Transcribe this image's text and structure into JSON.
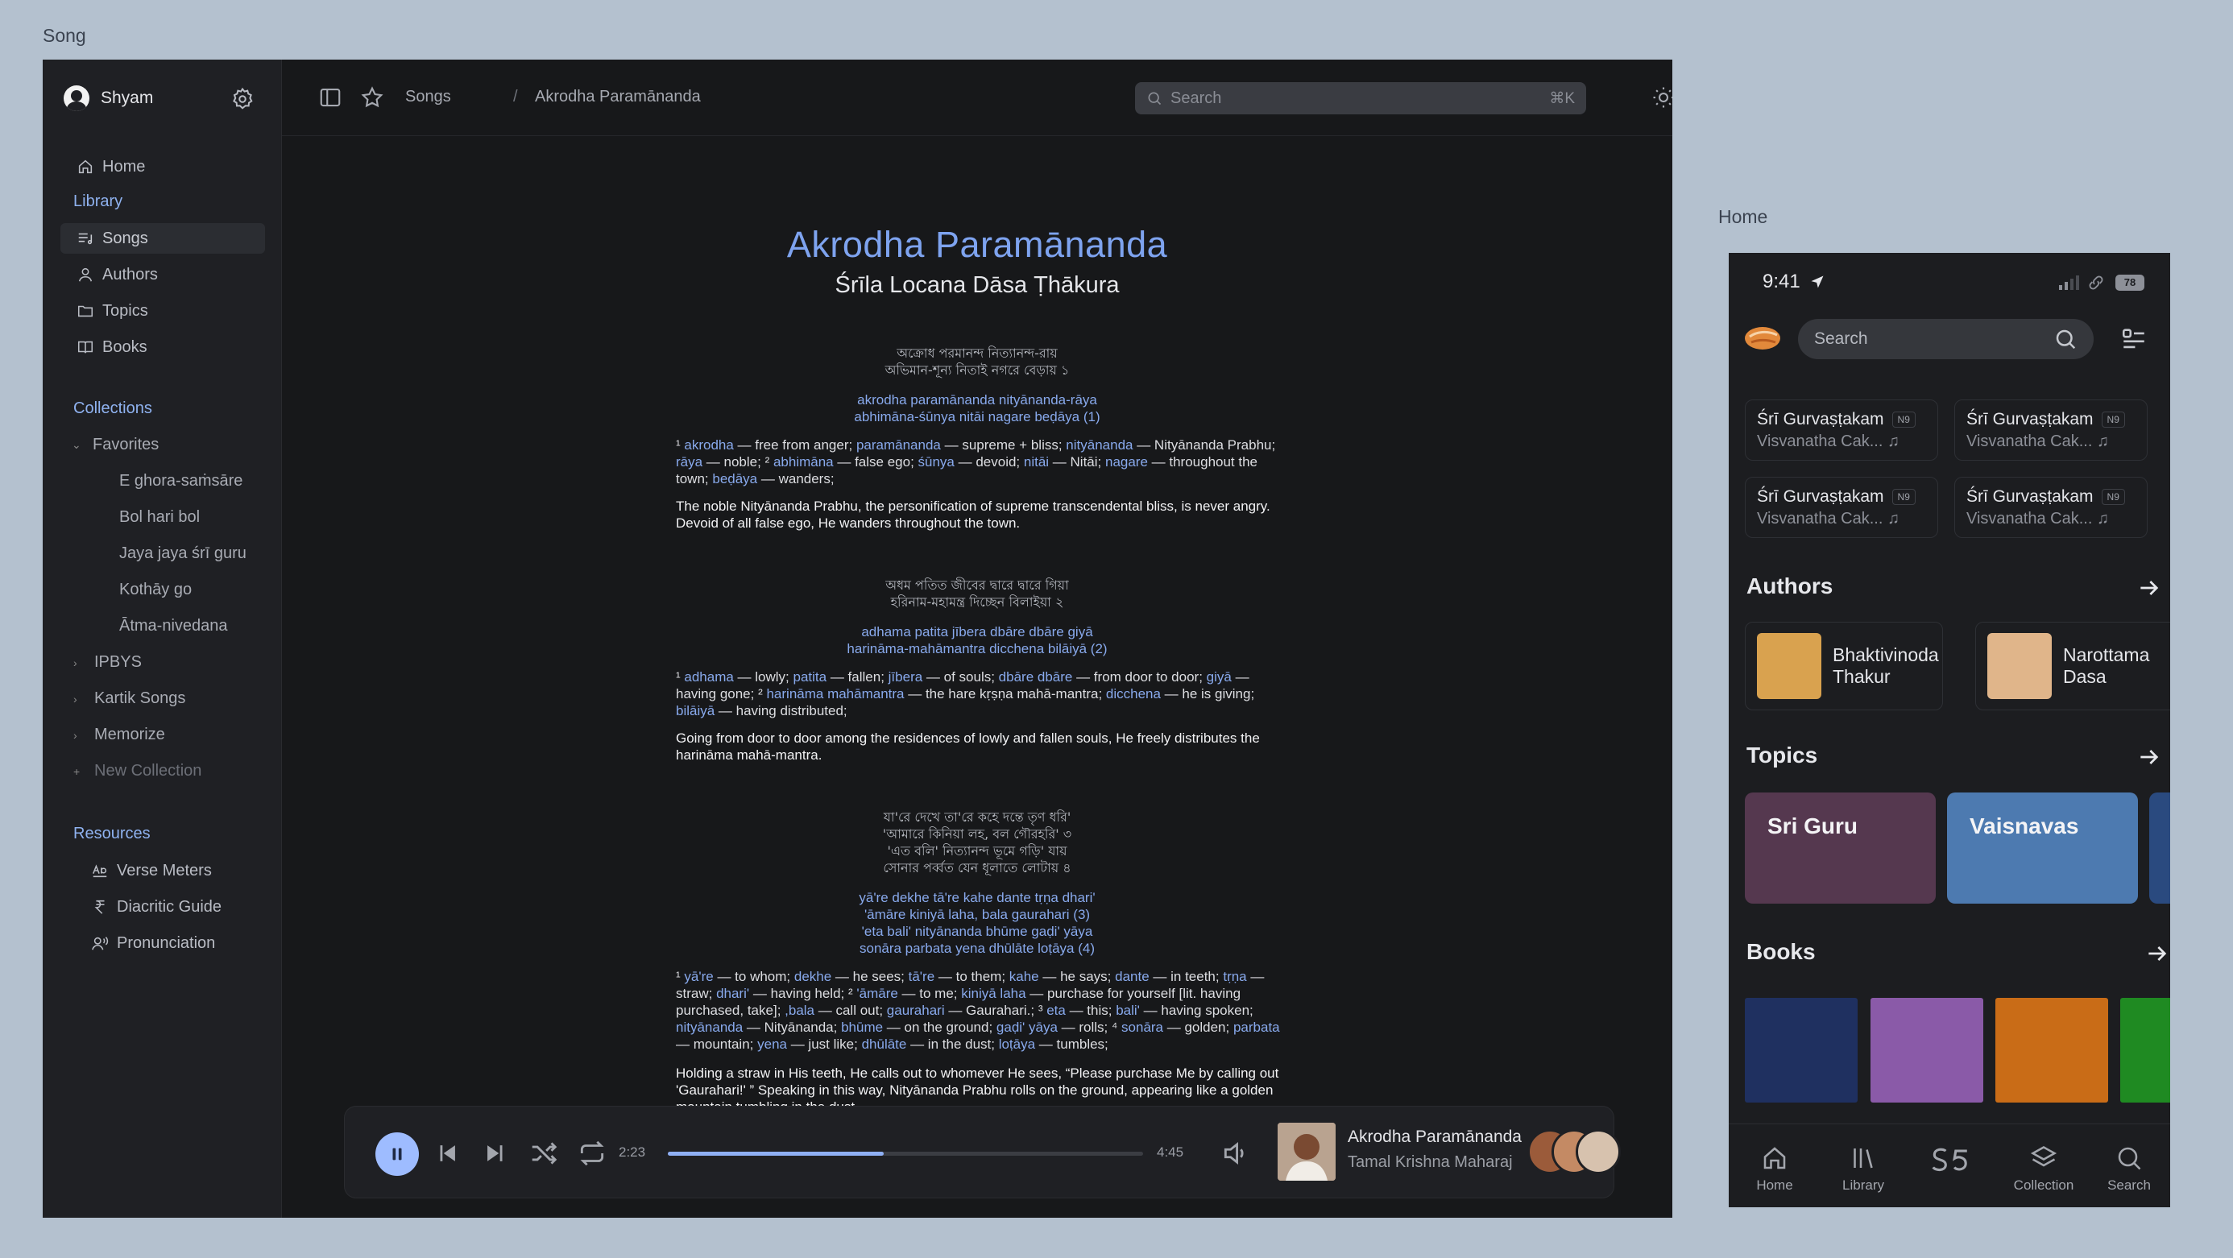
{
  "frames": {
    "song_label": "Song",
    "home_label": "Home"
  },
  "sidebar": {
    "user": "Shyam",
    "nav": [
      {
        "label": "Home"
      }
    ],
    "library_heading": "Library",
    "library": [
      {
        "label": "Songs"
      },
      {
        "label": "Authors"
      },
      {
        "label": "Topics"
      },
      {
        "label": "Books"
      }
    ],
    "collections_heading": "Collections",
    "favorites_label": "Favorites",
    "favorites": [
      "E ghora-saṁsāre",
      "Bol hari bol",
      "Jaya jaya śrī guru",
      "Kothāy go",
      "Ātma-nivedana"
    ],
    "folders": [
      "IPBYS",
      "Kartik Songs",
      "Memorize"
    ],
    "new_collection": "New Collection",
    "resources_heading": "Resources",
    "resources": [
      {
        "label": "Verse Meters"
      },
      {
        "label": "Diacritic Guide"
      },
      {
        "label": "Pronunciation"
      }
    ]
  },
  "topbar": {
    "crumb_root": "Songs",
    "crumb_sep": "/",
    "crumb_current": "Akrodha Paramānanda",
    "search_placeholder": "Search",
    "search_shortcut": "⌘K"
  },
  "song": {
    "title": "Akrodha Paramānanda",
    "author": "Śrīla Locana Dāsa Ṭhākura",
    "verses": [
      {
        "bengali": [
          "অক্রোধ পরমানন্দ নিত্যানন্দ-রায়",
          "অভিমান-শূন্য নিতাই নগরে বেড়ায়    ১"
        ],
        "translit": [
          "akrodha paramānanda nityānanda-rāya",
          "abhimāna-śūnya nitāi nagare beḍāya (1)"
        ],
        "synonyms": [
          [
            [
              "¹ ",
              ""
            ],
            [
              "akrodha",
              "w"
            ],
            [
              " — free from anger;  ",
              ""
            ],
            [
              "paramānanda",
              "w"
            ],
            [
              " — supreme + bliss;  ",
              ""
            ],
            [
              "nityānanda",
              "w"
            ],
            [
              " — Nityānanda Prabhu;",
              ""
            ]
          ],
          [
            [
              "rāya",
              "w"
            ],
            [
              " — noble;  ² ",
              ""
            ],
            [
              "abhimāna",
              "w"
            ],
            [
              " — false ego;  ",
              ""
            ],
            [
              "śūnya",
              "w"
            ],
            [
              " — devoid;  ",
              ""
            ],
            [
              "nitāi",
              "w"
            ],
            [
              " — Nitāi;  ",
              ""
            ],
            [
              "nagare",
              "w"
            ],
            [
              " — throughout the",
              ""
            ]
          ],
          [
            [
              "town;  ",
              ""
            ],
            [
              "beḍāya",
              "w"
            ],
            [
              " — wanders;",
              ""
            ]
          ]
        ],
        "translation": [
          "The noble Nityānanda Prabhu, the personification of supreme transcendental bliss, is never angry.",
          "Devoid of all false ego, He wanders throughout the town."
        ]
      },
      {
        "bengali": [
          "অধম পতিত জীবের দ্বারে দ্বারে গিয়া",
          "হরিনাম-মহামন্ত্র দিচ্ছেন বিলাইয়া    ২"
        ],
        "translit": [
          "adhama patita jībera dbāre dbāre giyā",
          "harināma-mahāmantra dicchena bilāiyā (2)"
        ],
        "synonyms": [
          [
            [
              "¹ ",
              ""
            ],
            [
              "adhama",
              "w"
            ],
            [
              " — lowly;  ",
              ""
            ],
            [
              "patita",
              "w"
            ],
            [
              " — fallen;  ",
              ""
            ],
            [
              "jībera",
              "w"
            ],
            [
              " — of souls;  ",
              ""
            ],
            [
              "dbāre dbāre",
              "w"
            ],
            [
              " — from door to door;  ",
              ""
            ],
            [
              "giyā",
              "w"
            ],
            [
              " —",
              ""
            ]
          ],
          [
            [
              "having gone;  ² ",
              ""
            ],
            [
              "harināma mahāmantra",
              "w"
            ],
            [
              " — the hare kṛṣṇa mahā-mantra;  ",
              ""
            ],
            [
              "dicchena",
              "w"
            ],
            [
              " — he is giving;",
              ""
            ]
          ],
          [
            [
              "bilāiyā",
              "w"
            ],
            [
              " — having distributed;",
              ""
            ]
          ]
        ],
        "translation": [
          "Going from door to door among the residences of lowly and fallen souls, He freely distributes the",
          "harināma mahā-mantra."
        ]
      },
      {
        "bengali": [
          "যা'রে দেখে তা'রে কহে দন্তে তৃণ ধরি'",
          "'আমারে কিনিয়া লহ, বল গৌরহরি'    ৩",
          "'এত বলি' নিত্যানন্দ ভূমে গড়ি' যায়",
          "সোনার পর্ব্বত যেন ধূলাতে লোটায়    ৪"
        ],
        "translit": [
          "yā're dekhe tā're kahe dante tṛṇa dhari'",
          "'āmāre kiniyā laha, bala gaurahari (3)",
          "'eta bali' nityānanda bhūme gaḍi' yāya",
          "sonāra parbata yena dhūlāte loṭāya (4)"
        ],
        "synonyms": [
          [
            [
              "¹ ",
              ""
            ],
            [
              "yā're",
              "w"
            ],
            [
              " — to whom;  ",
              ""
            ],
            [
              "dekhe",
              "w"
            ],
            [
              " — he sees;  ",
              ""
            ],
            [
              "tā're",
              "w"
            ],
            [
              " — to them;  ",
              ""
            ],
            [
              "kahe",
              "w"
            ],
            [
              " — he says;  ",
              ""
            ],
            [
              "dante",
              "w"
            ],
            [
              " — in teeth;  ",
              ""
            ],
            [
              "tṛṇa",
              "w"
            ],
            [
              " —",
              ""
            ]
          ],
          [
            [
              "straw;  ",
              ""
            ],
            [
              "dhari'",
              "w"
            ],
            [
              " — having held;  ² ",
              ""
            ],
            [
              "'āmāre",
              "w"
            ],
            [
              " — to me;  ",
              ""
            ],
            [
              "kiniyā laha",
              "w"
            ],
            [
              " — purchase for yourself [lit. having",
              ""
            ]
          ],
          [
            [
              "purchased, take];  ",
              ""
            ],
            [
              ",bala",
              "w"
            ],
            [
              " — call out;  ",
              ""
            ],
            [
              "gaurahari",
              "w"
            ],
            [
              " — Gaurahari.;  ³ ",
              ""
            ],
            [
              "eta",
              "w"
            ],
            [
              " — this;  ",
              ""
            ],
            [
              "bali'",
              "w"
            ],
            [
              " — having spoken;",
              ""
            ]
          ],
          [
            [
              "nityānanda",
              "w"
            ],
            [
              " — Nityānanda;  ",
              ""
            ],
            [
              "bhūme",
              "w"
            ],
            [
              " — on the ground;  ",
              ""
            ],
            [
              "gaḍi' yāya",
              "w"
            ],
            [
              " — rolls;  ⁴ ",
              ""
            ],
            [
              "sonāra",
              "w"
            ],
            [
              " — golden;  ",
              ""
            ],
            [
              "parbata",
              "w"
            ]
          ],
          [
            [
              "— mountain;  ",
              ""
            ],
            [
              "yena",
              "w"
            ],
            [
              " — just like;  ",
              ""
            ],
            [
              "dhūlāte",
              "w"
            ],
            [
              " — in the dust;  ",
              ""
            ],
            [
              "loṭāya",
              "w"
            ],
            [
              " — tumbles;",
              ""
            ]
          ]
        ],
        "translation": [
          "Holding a straw in His teeth, He calls out to whomever He sees, “Please purchase Me by calling out",
          "'Gaurahari!' ” Speaking in this way, Nityānanda Prabhu rolls on the ground, appearing like a golden",
          "mountain tumbling in the dust."
        ]
      }
    ]
  },
  "player": {
    "elapsed": "2:23",
    "duration": "4:45",
    "progress": 0.455,
    "track_title": "Akrodha Paramānanda",
    "track_artist": "Tamal Krishna Maharaj"
  },
  "phone": {
    "time": "9:41",
    "battery": "78",
    "search_placeholder": "Search",
    "recent_songs": [
      {
        "title": "Śrī Gurvaṣṭakam",
        "badge": "N9",
        "subtitle": "Visvanatha Cak..."
      },
      {
        "title": "Śrī Gurvaṣṭakam",
        "badge": "N9",
        "subtitle": "Visvanatha Cak..."
      },
      {
        "title": "Śrī Gurvaṣṭakam",
        "badge": "N9",
        "subtitle": "Visvanatha Cak..."
      },
      {
        "title": "Śrī Gurvaṣṭakam",
        "badge": "N9",
        "subtitle": "Visvanatha Cak..."
      }
    ],
    "authors_heading": "Authors",
    "authors": [
      {
        "line1": "Bhaktivinoda",
        "line2": "Thakur"
      },
      {
        "line1": "Narottama",
        "line2": "Dasa"
      }
    ],
    "topics_heading": "Topics",
    "topics": [
      {
        "label": "Sri Guru",
        "color": "#55384f"
      },
      {
        "label": "Vaisnavas",
        "color": "#4d7ab0"
      },
      {
        "label": "",
        "color": "#2a4a7f"
      }
    ],
    "books_heading": "Books",
    "book_colors": [
      "#1f3060",
      "#8a5aa8",
      "#c96c17",
      "#1f8a22"
    ],
    "tabs": [
      {
        "label": "Home"
      },
      {
        "label": "Library"
      },
      {
        "label": ""
      },
      {
        "label": "Collection"
      },
      {
        "label": "Search"
      }
    ]
  }
}
